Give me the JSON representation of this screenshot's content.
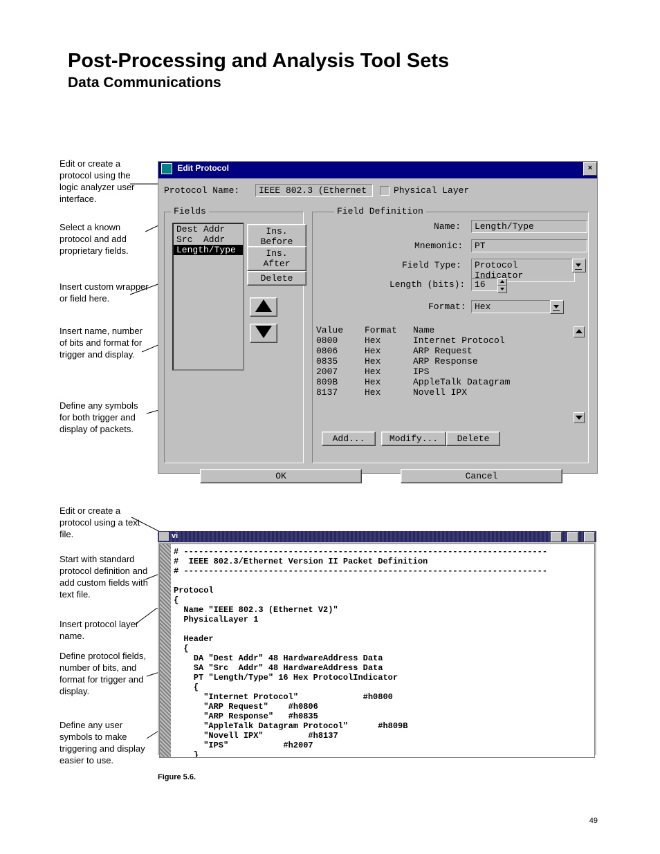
{
  "page": {
    "title": "Post-Processing and Analysis Tool Sets",
    "subtitle": "Data Communications",
    "number": "49",
    "figure_caption": "Figure 5.6."
  },
  "annotations": {
    "a1": "Edit or create a protocol using the logic analyzer user interface.",
    "a2": "Select a known protocol and add proprietary fields.",
    "a3": "Insert custom wrapper or field here.",
    "a4": "Insert name, number of bits and format for trigger and display.",
    "a5": "Define any symbols for both trigger and display of packets.",
    "a6": "Edit or create a protocol using a text file.",
    "a7": "Start with standard protocol definition and add custom fields with text file.",
    "a8": "Insert protocol layer name.",
    "a9": "Define protocol fields, number of bits, and format for trigger and display.",
    "a10": "Define any user symbols to make triggering and display easier to use."
  },
  "dialog": {
    "title": "Edit Protocol",
    "protocol_name_label": "Protocol Name:",
    "protocol_name_value": "IEEE 802.3 (Ethernet",
    "physical_layer_label": "Physical Layer",
    "fields_label": "Fields",
    "field_definition_label": "Field Definition",
    "fields_list": {
      "i0": "Dest Addr",
      "i1": "Src  Addr",
      "i2": "Length/Type"
    },
    "buttons": {
      "ins_before": "Ins. Before",
      "ins_after": "Ins. After",
      "delete": "Delete",
      "add": "Add...",
      "modify": "Modify...",
      "delete2": "Delete",
      "ok": "OK",
      "cancel": "Cancel"
    },
    "fd": {
      "name_label": "Name:",
      "name_value": "Length/Type",
      "mnemonic_label": "Mnemonic:",
      "mnemonic_value": "PT",
      "fieldtype_label": "Field Type:",
      "fieldtype_value": "Protocol Indicator",
      "length_label": "Length (bits):",
      "length_value": "16",
      "format_label": "Format:",
      "format_value": "Hex"
    },
    "table": {
      "h_value": "Value",
      "h_format": "Format",
      "h_name": "Name",
      "rows": [
        {
          "value": "0800",
          "format": "Hex",
          "name": "Internet Protocol"
        },
        {
          "value": "0806",
          "format": "Hex",
          "name": "ARP Request"
        },
        {
          "value": "0835",
          "format": "Hex",
          "name": "ARP Response"
        },
        {
          "value": "2007",
          "format": "Hex",
          "name": "IPS"
        },
        {
          "value": "809B",
          "format": "Hex",
          "name": "AppleTalk Datagram"
        },
        {
          "value": "8137",
          "format": "Hex",
          "name": "Novell IPX"
        }
      ]
    }
  },
  "terminal": {
    "title": "vi",
    "text": "# -------------------------------------------------------------------------\n#  IEEE 802.3/Ethernet Version II Packet Definition\n# -------------------------------------------------------------------------\n\nProtocol\n{\n  Name \"IEEE 802.3 (Ethernet V2)\"\n  PhysicalLayer 1\n\n  Header\n  {\n    DA \"Dest Addr\" 48 HardwareAddress Data\n    SA \"Src  Addr\" 48 HardwareAddress Data\n    PT \"Length/Type\" 16 Hex ProtocolIndicator\n    {\n      \"Internet Protocol\"             #h0800\n      \"ARP Request\"    #h0806\n      \"ARP Response\"   #h0835\n      \"AppleTalk Datagram Protocol\"      #h809B\n      \"Novell IPX\"         #h8137\n      \"IPS\"           #h2007\n    }\n  }\n}"
  }
}
